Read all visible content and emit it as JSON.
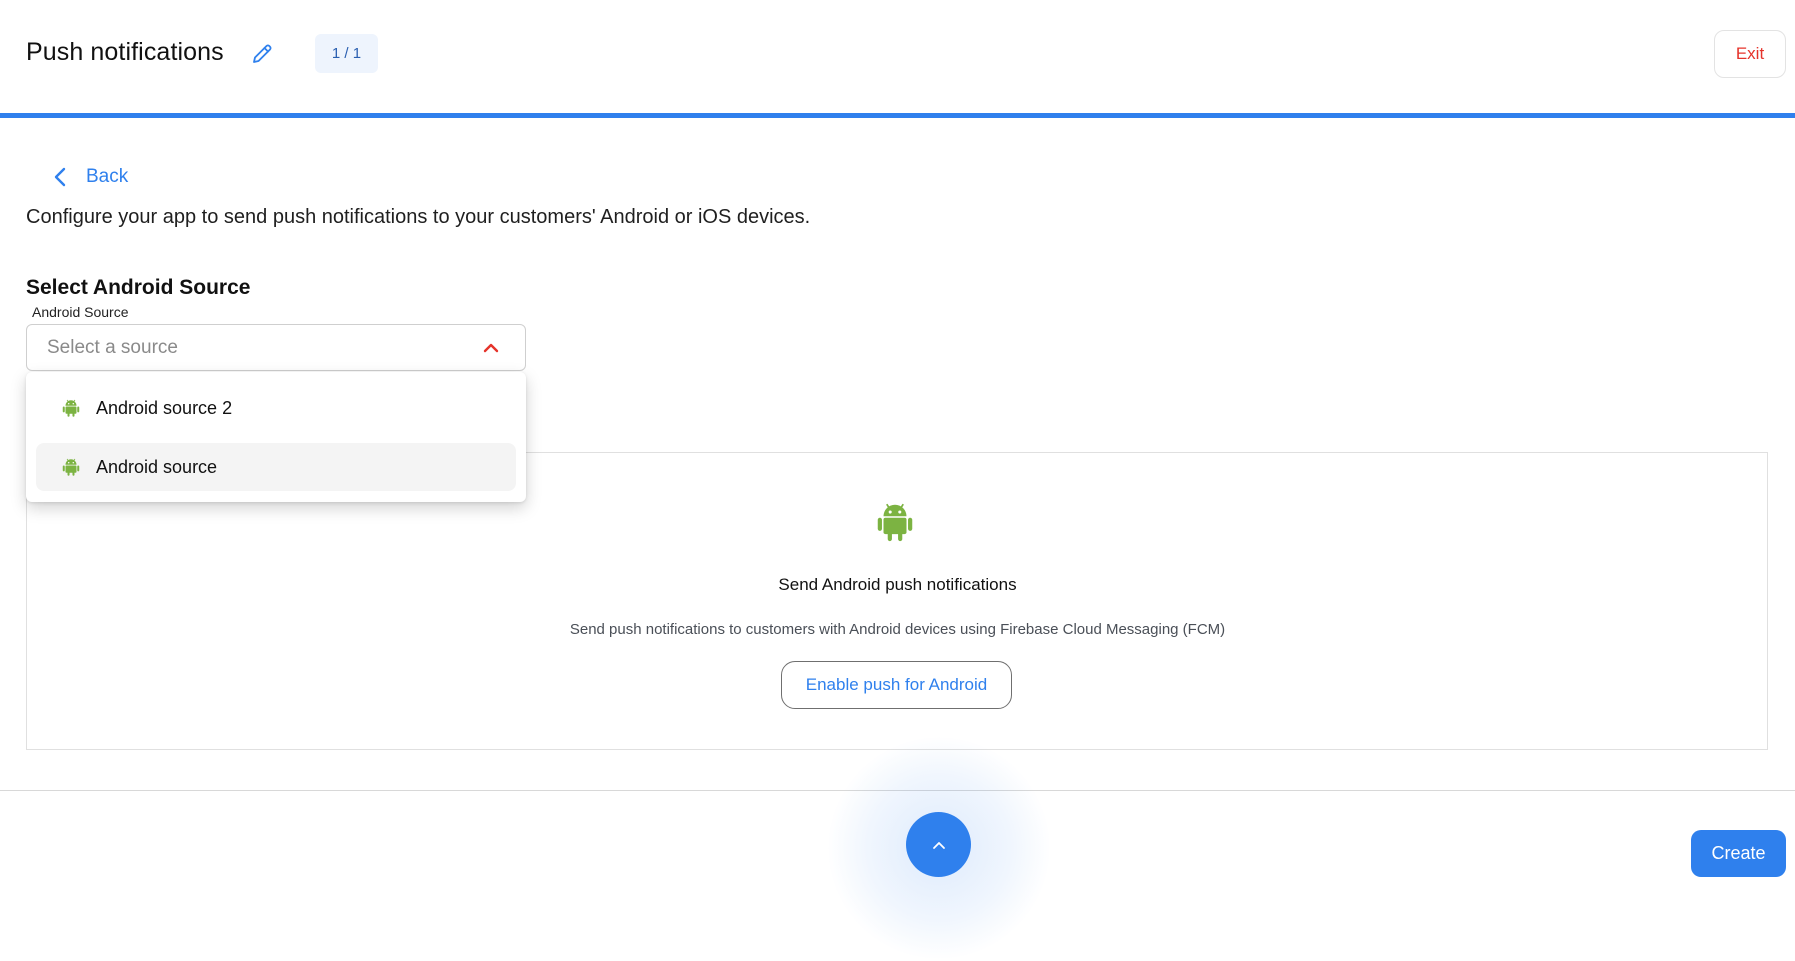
{
  "header": {
    "title": "Push notifications",
    "edit_icon": "pencil-icon",
    "step_indicator": "1 / 1",
    "exit_label": "Exit",
    "progress_color": "#2f80ed"
  },
  "nav": {
    "back_label": "Back",
    "back_icon": "chevron-left-icon"
  },
  "main": {
    "description": "Configure your app to send push notifications to your customers' Android or iOS devices.",
    "section_title": "Select Android Source",
    "field_label": "Android Source",
    "select_placeholder": "Select a source",
    "select_icon": "chevron-up-icon",
    "dropdown_options": [
      {
        "label": "Android source 2",
        "icon": "android-icon",
        "highlighted": false
      },
      {
        "label": "Android source",
        "icon": "android-icon",
        "highlighted": true
      }
    ]
  },
  "card": {
    "icon": "android-icon",
    "title": "Send Android push notifications",
    "subtitle": "Send push notifications to customers with Android devices using Firebase Cloud Messaging (FCM)",
    "button_label": "Enable push for Android"
  },
  "footer": {
    "scroll_up_icon": "chevron-up-icon",
    "create_label": "Create"
  },
  "colors": {
    "accent": "#2f80ed",
    "danger": "#e5332a",
    "android_green": "#7cb342"
  }
}
